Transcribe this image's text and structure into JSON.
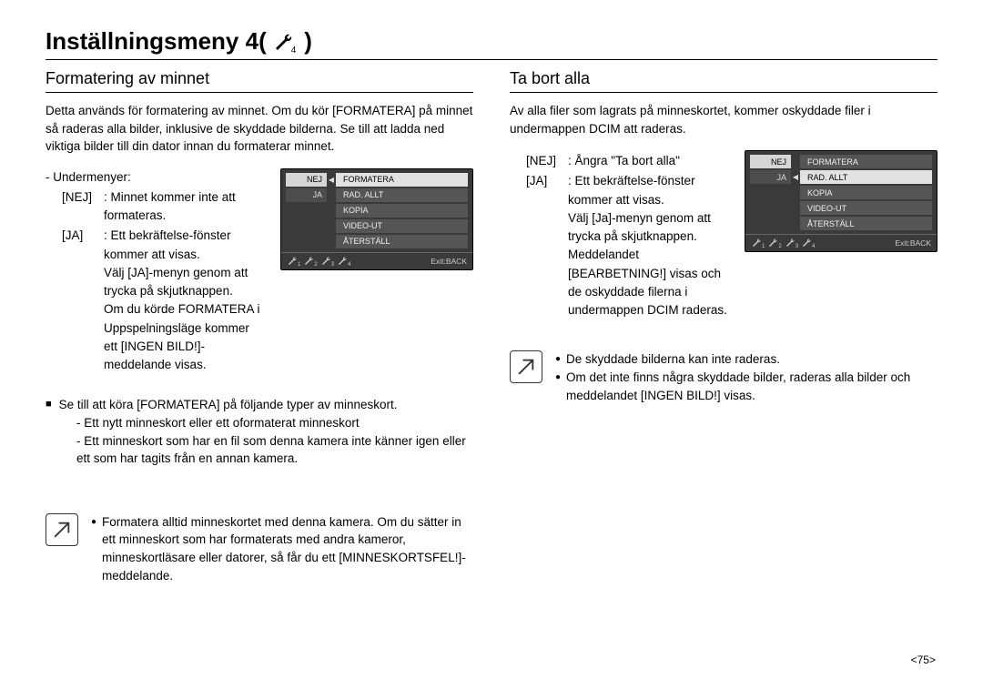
{
  "page": {
    "title_prefix": "Inställningsmeny 4(",
    "title_suffix": ")",
    "page_number": "<75>"
  },
  "icon": {
    "subscript": "4"
  },
  "left": {
    "heading": "Formatering av minnet",
    "intro": "Detta används för formatering av minnet. Om du kör [FORMATERA] på minnet så raderas alla bilder, inklusive de skyddade bilderna. Se till att ladda ned viktiga bilder till din dator innan du formaterar minnet.",
    "submenu_label": "- Undermenyer:",
    "rows": [
      {
        "key": "[NEJ]",
        "val": ": Minnet kommer inte att formateras."
      },
      {
        "key": "[JA]",
        "val": ": Ett bekräftelse-fönster kommer att visas."
      }
    ],
    "ja_extra1": "Välj [JA]-menyn genom att trycka på skjutknappen.",
    "ja_extra2": "Om du körde FORMATERA i Uppspelningsläge kommer ett [INGEN BILD!]-meddelande visas.",
    "panel": {
      "lines": [
        {
          "left": "NEJ",
          "selLeft": true,
          "sep": "◀",
          "right": "FORMATERA",
          "selRight": true
        },
        {
          "left": "JA",
          "selLeft": false,
          "sep": "",
          "right": "RAD. ALLT",
          "selRight": false
        },
        {
          "left": "",
          "selLeft": false,
          "sep": "",
          "right": "KOPIA",
          "selRight": false
        },
        {
          "left": "",
          "selLeft": false,
          "sep": "",
          "right": "VIDEO-UT",
          "selRight": false
        },
        {
          "left": "",
          "selLeft": false,
          "sep": "",
          "right": "ÅTERSTÄLL",
          "selRight": false
        }
      ],
      "bottom_idx": [
        "1",
        "2",
        "3",
        "4"
      ],
      "exit": "Exit:BACK"
    },
    "bullet_main": "Se till att köra [FORMATERA] på följande typer av minneskort.",
    "bullet_sub1": "- Ett nytt minneskort eller ett oformaterat minneskort",
    "bullet_sub2": "- Ett minneskort som har en fil som denna kamera inte känner igen eller ett som har tagits från en annan kamera.",
    "note": "Formatera alltid minneskortet med denna kamera. Om du sätter in ett minneskort som har formaterats med andra kameror, minneskortläsare eller datorer, så får du ett [MINNESKORTSFEL!]-meddelande."
  },
  "right": {
    "heading": "Ta bort alla",
    "intro": "Av alla filer som lagrats på minneskortet, kommer oskyddade filer i undermappen DCIM att raderas.",
    "rows": [
      {
        "key": "[NEJ]",
        "val": ": Ångra \"Ta bort alla\""
      },
      {
        "key": "[JA]",
        "val": ": Ett bekräftelse-fönster kommer att visas."
      }
    ],
    "ja_extra1": "Välj [Ja]-menyn genom att trycka på skjutknappen.",
    "ja_extra2": "Meddelandet [BEARBETNING!] visas och de oskyddade filerna i undermappen DCIM raderas.",
    "panel": {
      "lines": [
        {
          "left": "NEJ",
          "selLeft": true,
          "sep": "",
          "right": "FORMATERA",
          "selRight": false
        },
        {
          "left": "JA",
          "selLeft": false,
          "sep": "◀",
          "right": "RAD. ALLT",
          "selRight": true
        },
        {
          "left": "",
          "selLeft": false,
          "sep": "",
          "right": "KOPIA",
          "selRight": false
        },
        {
          "left": "",
          "selLeft": false,
          "sep": "",
          "right": "VIDEO-UT",
          "selRight": false
        },
        {
          "left": "",
          "selLeft": false,
          "sep": "",
          "right": "ÅTERSTÄLL",
          "selRight": false
        }
      ],
      "bottom_idx": [
        "1",
        "2",
        "3",
        "4"
      ],
      "exit": "Exit:BACK"
    },
    "note1": "De skyddade bilderna kan inte raderas.",
    "note2": "Om det inte finns några skyddade bilder, raderas alla bilder och meddelandet [INGEN BILD!] visas."
  }
}
